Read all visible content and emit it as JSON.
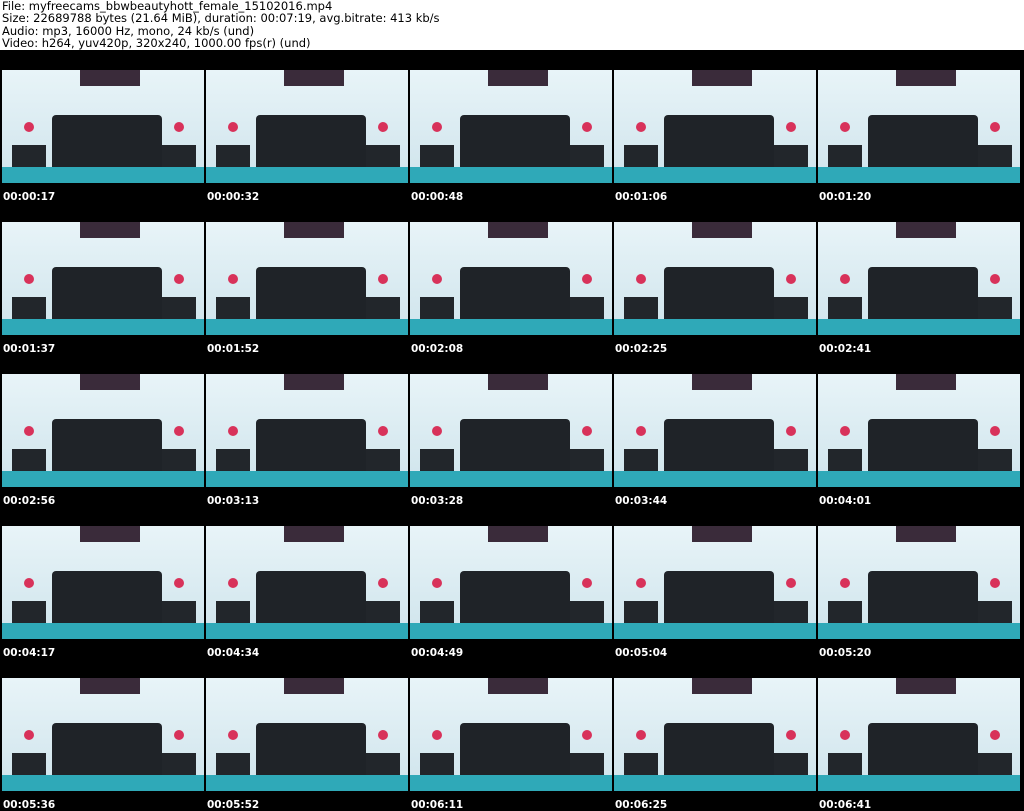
{
  "header": {
    "file": "File: myfreecams_bbwbeautyhott_female_15102016.mp4",
    "size": "Size: 22689788 bytes (21.64 MiB), duration: 00:07:19, avg.bitrate: 413 kb/s",
    "audio": "Audio: mp3, 16000 Hz, mono, 24 kb/s (und)",
    "video": "Video: h264, yuv420p, 320x240, 1000.00 fps(r) (und)"
  },
  "frames": [
    "00:00:17",
    "00:00:32",
    "00:00:48",
    "00:01:06",
    "00:01:20",
    "00:01:37",
    "00:01:52",
    "00:02:08",
    "00:02:25",
    "00:02:41",
    "00:02:56",
    "00:03:13",
    "00:03:28",
    "00:03:44",
    "00:04:01",
    "00:04:17",
    "00:04:34",
    "00:04:49",
    "00:05:04",
    "00:05:20",
    "00:05:36",
    "00:05:52",
    "00:06:11",
    "00:06:25",
    "00:06:41"
  ]
}
